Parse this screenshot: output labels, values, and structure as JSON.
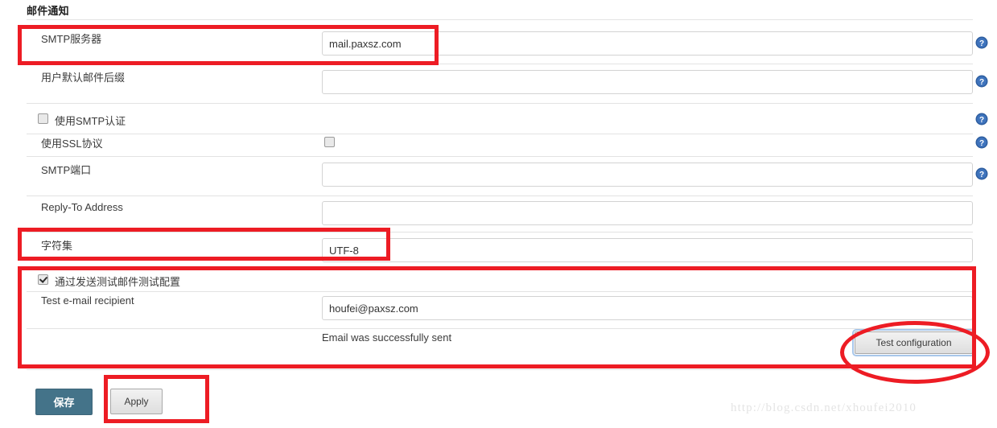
{
  "page": {
    "title": "邮件通知",
    "watermark": "http://blog.csdn.net/xhoufei2010"
  },
  "colors": {
    "accent_red": "#ed1c24",
    "primary_button": "#447389",
    "help_icon": "#2d5d9f",
    "input_border": "#d3d3d3",
    "separator": "#e3e3e3",
    "watermark": "#e4e4e4"
  },
  "fields": {
    "smtp_server": {
      "label": "SMTP服务器",
      "value": "mail.paxsz.com",
      "placeholder": ""
    },
    "default_suffix": {
      "label": "用户默认邮件后缀",
      "value": "",
      "placeholder": ""
    },
    "use_smtp_auth": {
      "label": "使用SMTP认证",
      "checked": false
    },
    "use_ssl": {
      "label": "使用SSL协议",
      "checked": false
    },
    "smtp_port": {
      "label": "SMTP端口",
      "value": "",
      "placeholder": ""
    },
    "reply_to": {
      "label": "Reply-To Address",
      "value": "",
      "placeholder": ""
    },
    "charset": {
      "label": "字符集",
      "value": "UTF-8",
      "placeholder": ""
    },
    "test_config_enable": {
      "label": "通过发送测试邮件测试配置",
      "checked": true
    },
    "test_recipient": {
      "label": "Test e-mail recipient",
      "value": "houfei@paxsz.com",
      "placeholder": ""
    }
  },
  "status": {
    "test_result": "Email was successfully sent"
  },
  "buttons": {
    "test_configuration": "Test configuration",
    "save": "保存",
    "apply": "Apply"
  },
  "icons": {
    "help": "?",
    "help_tooltip": "?"
  },
  "annotations": {
    "highlight_count": 5,
    "note": "red rectangles and ellipse markup overlay"
  }
}
